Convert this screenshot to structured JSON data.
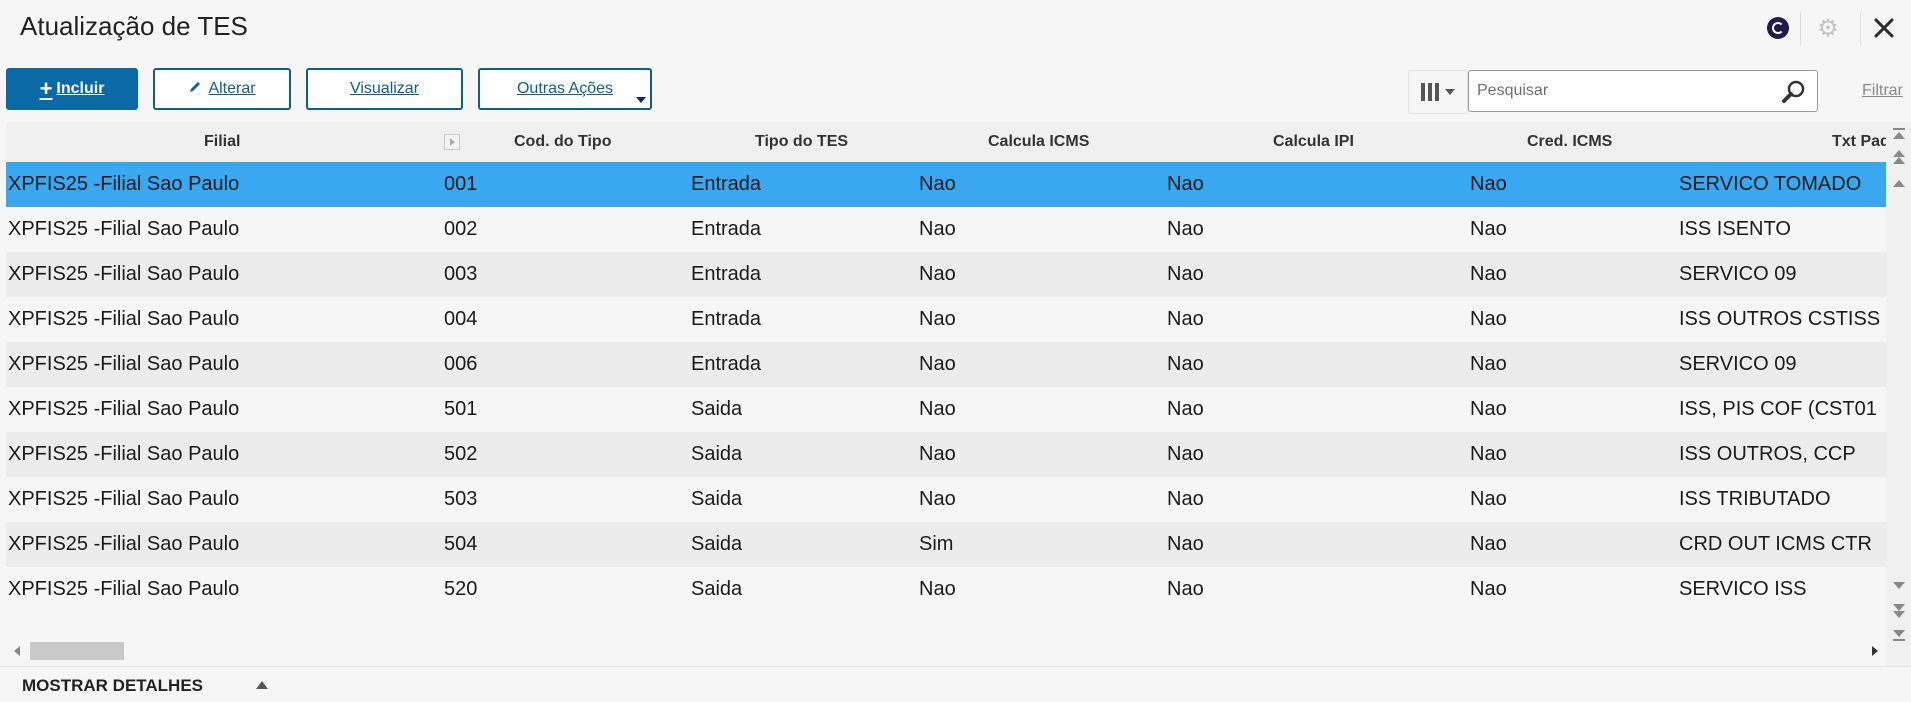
{
  "window": {
    "title": "Atualização de TES"
  },
  "icons": {
    "app": "app-logo-icon",
    "settings": "gear-icon",
    "close": "close-icon"
  },
  "toolbar": {
    "incluir": "Incluir",
    "alterar": "Alterar",
    "visualizar": "Visualizar",
    "outras_acoes": "Outras Ações"
  },
  "search": {
    "placeholder": "Pesquisar",
    "value": ""
  },
  "filter_label": "Filtrar",
  "table": {
    "columns": [
      "Filial",
      "Cod. do Tipo",
      "Tipo do TES",
      "Calcula ICMS",
      "Calcula IPI",
      "Cred. ICMS",
      "Txt Pad"
    ],
    "rows": [
      [
        "XPFIS25 -Filial Sao Paulo",
        "001",
        "Entrada",
        "Nao",
        "Nao",
        "Nao",
        "SERVICO TOMADO"
      ],
      [
        "XPFIS25 -Filial Sao Paulo",
        "002",
        "Entrada",
        "Nao",
        "Nao",
        "Nao",
        "ISS ISENTO"
      ],
      [
        "XPFIS25 -Filial Sao Paulo",
        "003",
        "Entrada",
        "Nao",
        "Nao",
        "Nao",
        "SERVICO 09"
      ],
      [
        "XPFIS25 -Filial Sao Paulo",
        "004",
        "Entrada",
        "Nao",
        "Nao",
        "Nao",
        "ISS OUTROS CSTISS"
      ],
      [
        "XPFIS25 -Filial Sao Paulo",
        "006",
        "Entrada",
        "Nao",
        "Nao",
        "Nao",
        "SERVICO 09"
      ],
      [
        "XPFIS25 -Filial Sao Paulo",
        "501",
        "Saida",
        "Nao",
        "Nao",
        "Nao",
        "ISS, PIS COF (CST01"
      ],
      [
        "XPFIS25 -Filial Sao Paulo",
        "502",
        "Saida",
        "Nao",
        "Nao",
        "Nao",
        "ISS OUTROS, CCP"
      ],
      [
        "XPFIS25 -Filial Sao Paulo",
        "503",
        "Saida",
        "Nao",
        "Nao",
        "Nao",
        "ISS TRIBUTADO"
      ],
      [
        "XPFIS25 -Filial Sao Paulo",
        "504",
        "Saida",
        "Sim",
        "Nao",
        "Nao",
        "CRD OUT ICMS CTR"
      ],
      [
        "XPFIS25 -Filial Sao Paulo",
        "520",
        "Saida",
        "Nao",
        "Nao",
        "Nao",
        "SERVICO ISS"
      ]
    ]
  },
  "footer": {
    "details_label": "MOSTRAR DETALHES"
  }
}
